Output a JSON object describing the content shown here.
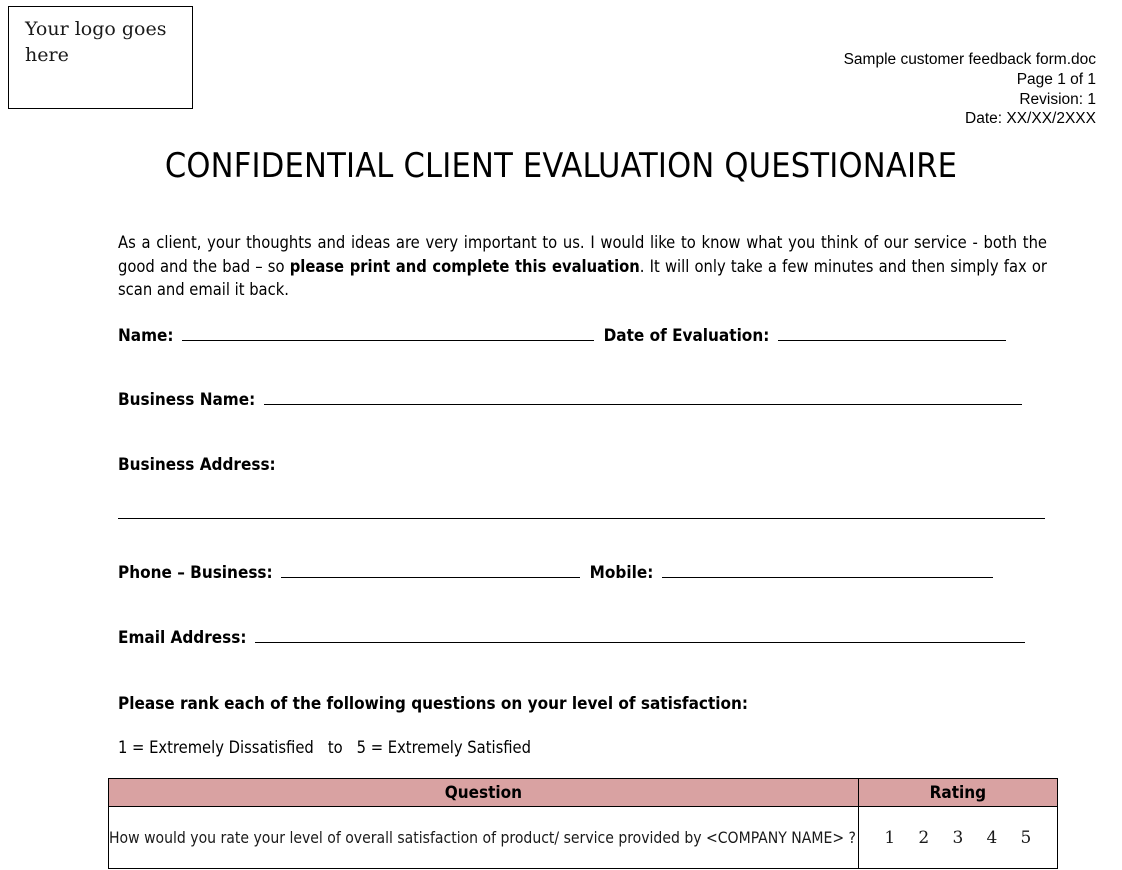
{
  "header": {
    "logo_placeholder": "Your logo goes here",
    "doc_name": "Sample customer feedback form.doc",
    "page_info": "Page 1 of 1",
    "revision": "Revision: 1",
    "date": "Date: XX/XX/2XXX"
  },
  "title": "CONFIDENTIAL  CLIENT EVALUATION QUESTIONAIRE",
  "intro": {
    "part1": "As a client, your thoughts and ideas are very important to us. I would like to know what you think of our service - both the good and the bad – so ",
    "bold": "please print and complete this evaluation",
    "part2": ". It will only take a few minutes and then simply fax or scan and email it back."
  },
  "fields": {
    "name_label": "Name:",
    "date_of_evaluation_label": "Date of Evaluation:",
    "business_name_label": "Business Name:",
    "business_address_label": "Business Address:",
    "phone_business_label": "Phone – Business:",
    "mobile_label": "Mobile:",
    "email_label": "Email Address:",
    "name_value": "",
    "date_of_evaluation_value": "",
    "business_name_value": "",
    "business_address_value": "",
    "phone_business_value": "",
    "mobile_value": "",
    "email_value": ""
  },
  "ranking": {
    "heading": "Please rank each of the following questions on your level of satisfaction:",
    "scale_text": "1 = Extremely Dissatisfied   to   5 = Extremely Satisfied"
  },
  "table": {
    "headers": {
      "question": "Question",
      "rating": "Rating"
    },
    "header_fill": "#d9a2a2",
    "rows": [
      {
        "question": "How would you rate your level of overall satisfaction of product/ service provided by <COMPANY NAME> ?",
        "ratings": [
          "1",
          "2",
          "3",
          "4",
          "5"
        ]
      }
    ]
  }
}
